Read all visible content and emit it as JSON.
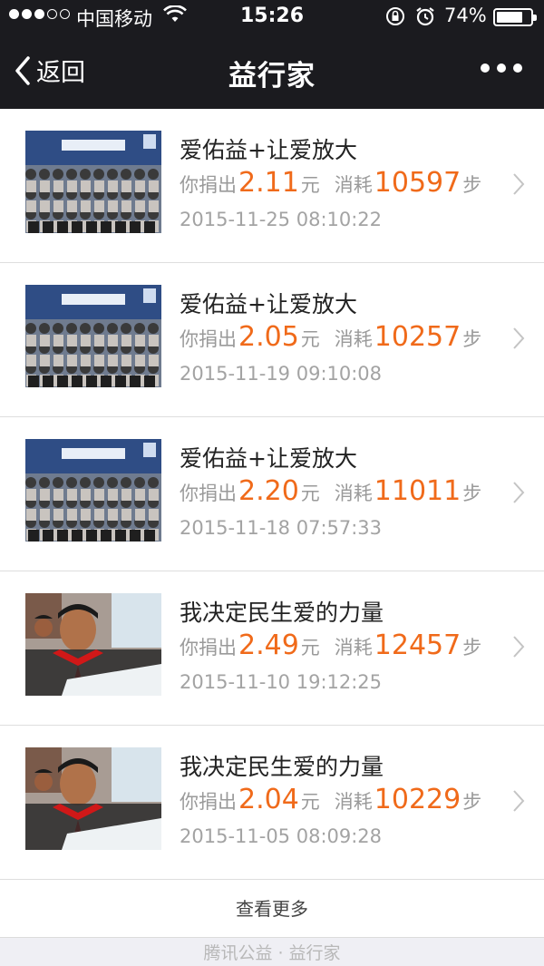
{
  "status": {
    "carrier": "中国移动",
    "time": "15:26",
    "battery": "74%",
    "battery_level": 0.74
  },
  "nav": {
    "back_label": "返回",
    "title": "益行家"
  },
  "records": [
    {
      "title": "爱佑益+让爱放大",
      "donate_prefix": "你捐出",
      "amount": "2.11",
      "currency": "元",
      "consume_prefix": "消耗",
      "steps": "10597",
      "steps_unit": "步",
      "date": "2015-11-25 08:10:22",
      "thumb": "group-photo"
    },
    {
      "title": "爱佑益+让爱放大",
      "donate_prefix": "你捐出",
      "amount": "2.05",
      "currency": "元",
      "consume_prefix": "消耗",
      "steps": "10257",
      "steps_unit": "步",
      "date": "2015-11-19 09:10:08",
      "thumb": "group-photo"
    },
    {
      "title": "爱佑益+让爱放大",
      "donate_prefix": "你捐出",
      "amount": "2.20",
      "currency": "元",
      "consume_prefix": "消耗",
      "steps": "11011",
      "steps_unit": "步",
      "date": "2015-11-18 07:57:33",
      "thumb": "group-photo"
    },
    {
      "title": "我决定民生爱的力量",
      "donate_prefix": "你捐出",
      "amount": "2.49",
      "currency": "元",
      "consume_prefix": "消耗",
      "steps": "12457",
      "steps_unit": "步",
      "date": "2015-11-10 19:12:25",
      "thumb": "child-photo"
    },
    {
      "title": "我决定民生爱的力量",
      "donate_prefix": "你捐出",
      "amount": "2.04",
      "currency": "元",
      "consume_prefix": "消耗",
      "steps": "10229",
      "steps_unit": "步",
      "date": "2015-11-05 08:09:28",
      "thumb": "child-photo"
    }
  ],
  "more_label": "查看更多",
  "footer": "腾讯公益 · 益行家",
  "colors": {
    "accent": "#f06a1a",
    "topbar": "#1b1b1f",
    "muted_text": "#9a9a9a"
  }
}
